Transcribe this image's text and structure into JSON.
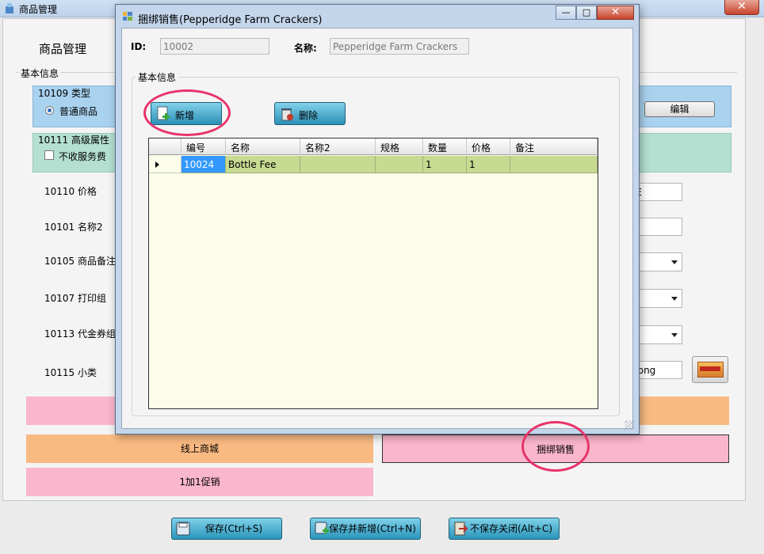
{
  "main_window": {
    "title": "商品管理",
    "close_symbol": "✕",
    "page_title": "商品管理",
    "basic_info_label": "基本信息"
  },
  "type_section": {
    "label": "10109 类型",
    "radio_label": "普通商品",
    "edit_button": "编辑"
  },
  "advanced_section": {
    "label": "10111 高级属性",
    "checkbox_label": "不收服务费"
  },
  "fields": [
    {
      "label": "10110 价格",
      "value": "GE"
    },
    {
      "label": "10101 名称2",
      "value": ""
    },
    {
      "label": "10105 商品备注"
    },
    {
      "label": "10107 打印组"
    },
    {
      "label": "10113 代金券组"
    },
    {
      "label": "10115 小类",
      "value": "2.png"
    }
  ],
  "bars": {
    "online_mall": "线上商城",
    "bundle_sale": "捆绑销售",
    "buy_one_get_one": "1加1促销"
  },
  "bottom_buttons": {
    "save": "保存(Ctrl+S)",
    "save_new": "保存并新增(Ctrl+N)",
    "close_no_save": "不保存关闭(Alt+C)"
  },
  "dialog": {
    "title": "捆绑销售(Pepperidge Farm Crackers)",
    "minimize_symbol": "—",
    "maximize_symbol": "□",
    "close_symbol": "✕",
    "id_label": "ID:",
    "id_value": "10002",
    "name_label": "名称:",
    "name_value": "Pepperidge Farm Crackers",
    "group_label": "基本信息",
    "add_button": "新增",
    "delete_button": "删除",
    "grid": {
      "columns": [
        "编号",
        "名称",
        "名称2",
        "规格",
        "数量",
        "价格",
        "备注"
      ],
      "rows": [
        [
          "10024",
          "Bottle Fee",
          "",
          "",
          "1",
          "1",
          ""
        ]
      ]
    }
  },
  "colors": {
    "blue_band": "#a9d2ef",
    "teal_band": "#b4dfd1",
    "pink": "#f9b6cc",
    "orange": "#f9ba82",
    "grid_row": "#c7da92",
    "grid_bg": "#fbfde8",
    "annotation": "#e8336a",
    "button": "#2b8fb7"
  }
}
